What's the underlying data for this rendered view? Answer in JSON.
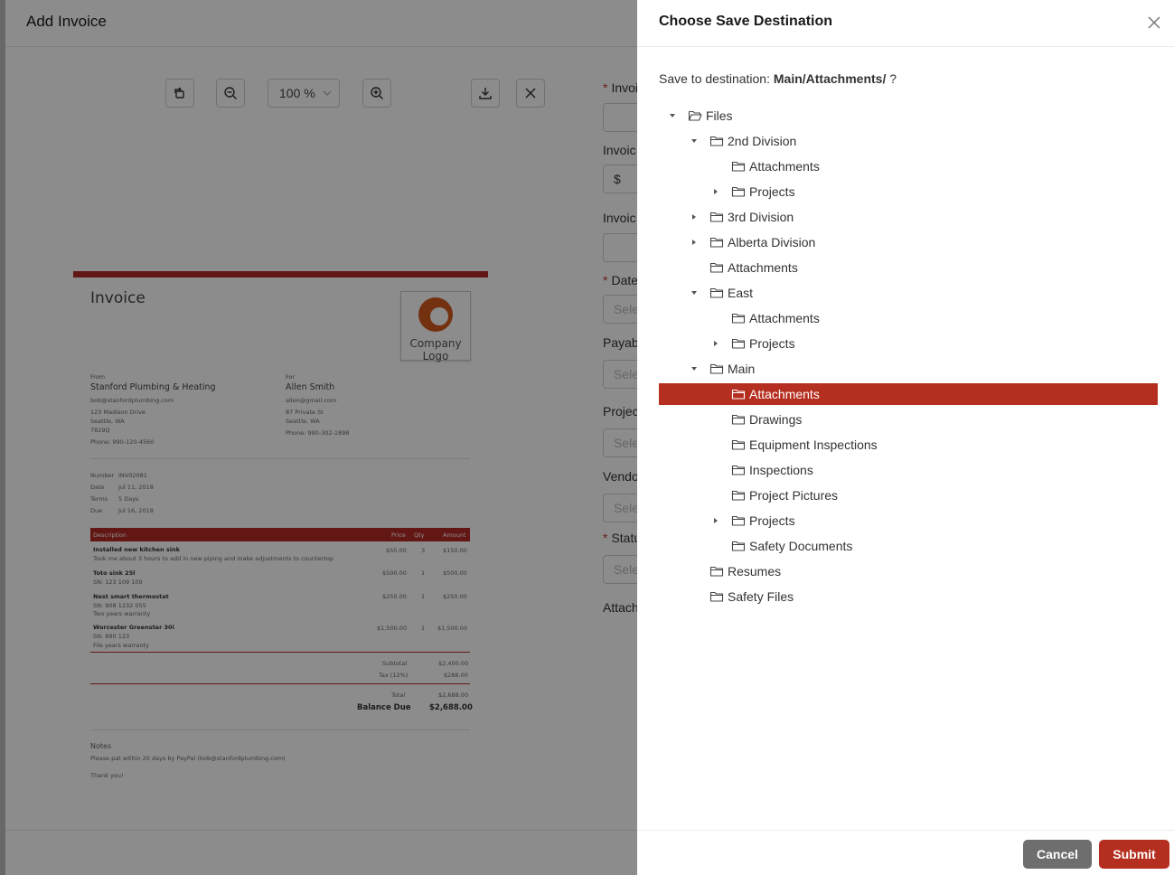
{
  "background": {
    "title": "Add Invoice",
    "zoom": "100 %",
    "form_labels": [
      {
        "text": "Invoi",
        "required": true
      },
      {
        "text": "Invoic",
        "required": false
      },
      {
        "text": "Invoic",
        "required": false
      },
      {
        "text": "Date",
        "required": true
      },
      {
        "text": "Payab",
        "required": false
      },
      {
        "text": "Projec",
        "required": false
      },
      {
        "text": "Vendo",
        "required": false
      },
      {
        "text": "Statu",
        "required": true
      },
      {
        "text": "Attach",
        "required": false
      }
    ],
    "form_inputs": [
      "",
      "$",
      "",
      "Sele",
      "Sele",
      "Sele",
      "Sele",
      "Sele"
    ],
    "invoice": {
      "title": "Invoice",
      "logo_text": "Company Logo",
      "from_label": "From",
      "from_name": "Stanford Plumbing & Heating",
      "from_email": "bob@stanfordplumbing.com",
      "from_addr1": "123 Madison Drive",
      "from_addr2": "Seattle, WA",
      "from_addr3": "7829Q",
      "from_phone": "Phone: 990-120-4560",
      "for_label": "For",
      "for_name": "Allen Smith",
      "for_email": "allen@gmail.com",
      "for_addr1": "87 Private St",
      "for_addr2": "Seattle, WA",
      "for_phone": "Phone: 990-302-1898",
      "meta": [
        {
          "k": "Number",
          "v": "INV02081"
        },
        {
          "k": "Date",
          "v": "Jul 11, 2018"
        },
        {
          "k": "Terms",
          "v": "5 Days"
        },
        {
          "k": "Due",
          "v": "Jul 16, 2018"
        }
      ],
      "columns": [
        "Description",
        "Price",
        "Qty",
        "Amount"
      ],
      "items": [
        {
          "name": "Installed new kitchen sink",
          "note1": "Took me about 3 hours to add in new piping and make adjustments to countertop",
          "note2": "",
          "price": "$50.00",
          "qty": "3",
          "amount": "$150.00"
        },
        {
          "name": "Toto sink 25l",
          "note1": "SN: 123 109 109",
          "note2": "",
          "price": "$500.00",
          "qty": "1",
          "amount": "$500.00"
        },
        {
          "name": "Nest smart thermostat",
          "note1": "SN: 908 1232 055",
          "note2": "Two years warranty",
          "price": "$250.00",
          "qty": "1",
          "amount": "$250.00"
        },
        {
          "name": "Worcester Greenstar 30i",
          "note1": "SN: 890 123",
          "note2": "File years warranty",
          "price": "$1,500.00",
          "qty": "1",
          "amount": "$1,500.00"
        }
      ],
      "subtotal_label": "Subtotal",
      "subtotal": "$2,400.00",
      "tax_label": "Tax (12%)",
      "tax": "$288.00",
      "total_label": "Total",
      "total": "$2,688.00",
      "balance_label": "Balance Due",
      "balance": "$2,688.00",
      "notes_label": "Notes",
      "notes_text": "Please pat within 20 days by PayPal (bob@stanfordplumbing.com)",
      "thanks": "Thank you!"
    }
  },
  "drawer": {
    "title": "Choose Save Destination",
    "prompt_prefix": "Save to destination:",
    "prompt_path": "Main/Attachments/",
    "prompt_suffix": "?",
    "tree": [
      {
        "label": "Files",
        "level": 0,
        "caret": "down",
        "open": true
      },
      {
        "label": "2nd Division",
        "level": 1,
        "caret": "down"
      },
      {
        "label": "Attachments",
        "level": 2,
        "caret": "none"
      },
      {
        "label": "Projects",
        "level": 2,
        "caret": "right"
      },
      {
        "label": "3rd Division",
        "level": 1,
        "caret": "right"
      },
      {
        "label": "Alberta Division",
        "level": 1,
        "caret": "right"
      },
      {
        "label": "Attachments",
        "level": 1,
        "caret": "none"
      },
      {
        "label": "East",
        "level": 1,
        "caret": "down"
      },
      {
        "label": "Attachments",
        "level": 2,
        "caret": "none"
      },
      {
        "label": "Projects",
        "level": 2,
        "caret": "right"
      },
      {
        "label": "Main",
        "level": 1,
        "caret": "down"
      },
      {
        "label": "Attachments",
        "level": 2,
        "caret": "none",
        "selected": true
      },
      {
        "label": "Drawings",
        "level": 2,
        "caret": "none"
      },
      {
        "label": "Equipment Inspections",
        "level": 2,
        "caret": "none"
      },
      {
        "label": "Inspections",
        "level": 2,
        "caret": "none"
      },
      {
        "label": "Project Pictures",
        "level": 2,
        "caret": "none"
      },
      {
        "label": "Projects",
        "level": 2,
        "caret": "right"
      },
      {
        "label": "Safety Documents",
        "level": 2,
        "caret": "none"
      },
      {
        "label": "Resumes",
        "level": 1,
        "caret": "none"
      },
      {
        "label": "Safety Files",
        "level": 1,
        "caret": "none"
      }
    ],
    "cancel_label": "Cancel",
    "submit_label": "Submit"
  },
  "colors": {
    "accent": "#b52f20",
    "cancel": "#6e6e6e"
  }
}
